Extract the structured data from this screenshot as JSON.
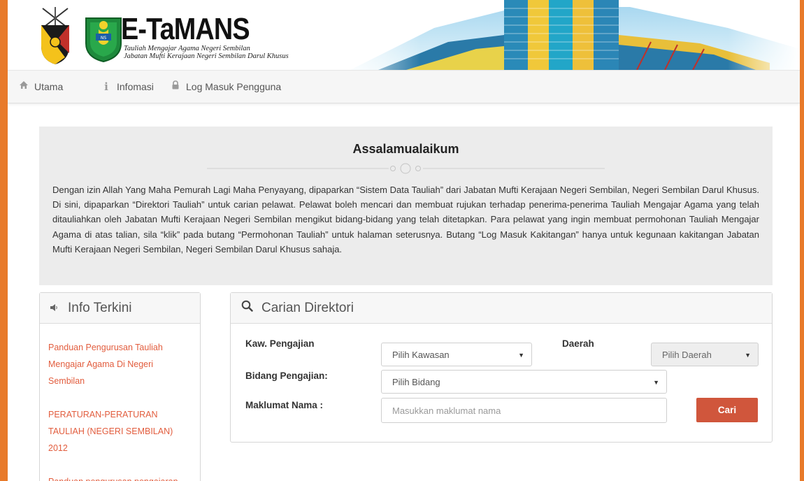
{
  "brand": {
    "title": "E-TaMANS",
    "subtitle_line1": "Tauliah Mengajar Agama Negeri Sembilan",
    "subtitle_line2": "Jabatan Mufti Kerajaan Negeri Sembilan Darul Khusus"
  },
  "nav": {
    "items": [
      {
        "label": "Utama",
        "icon": "home-icon"
      },
      {
        "label": "Infomasi",
        "icon": "info-icon"
      },
      {
        "label": "Log Masuk Pengguna",
        "icon": "lock-icon"
      }
    ]
  },
  "welcome": {
    "title": "Assalamualaikum",
    "text": "Dengan izin Allah Yang Maha Pemurah Lagi Maha Penyayang, dipaparkan “Sistem Data Tauliah” dari Jabatan Mufti Kerajaan Negeri Sembilan, Negeri Sembilan Darul Khusus. Di sini, dipaparkan “Direktori Tauliah” untuk carian pelawat. Pelawat boleh mencari dan membuat rujukan terhadap penerima-penerima Tauliah Mengajar Agama yang telah ditauliahkan oleh Jabatan Mufti Kerajaan Negeri Sembilan mengikut bidang-bidang yang telah ditetapkan. Para pelawat yang ingin membuat permohonan Tauliah Mengajar Agama di atas talian, sila “klik” pada butang “Permohonan Tauliah” untuk halaman seterusnya. Butang “Log Masuk Kakitangan” hanya untuk kegunaan kakitangan Jabatan Mufti Kerajaan Negeri Sembilan, Negeri Sembilan Darul Khusus sahaja."
  },
  "info": {
    "title": "Info Terkini",
    "icon": "speaker-icon",
    "links": [
      "Panduan Pengurusan Tauliah Mengajar Agama Di Negeri Sembilan",
      "PERATURAN-PERATURAN TAULIAH (NEGERI SEMBILAN) 2012",
      "Panduan pengurusan pengajaran"
    ]
  },
  "search": {
    "title": "Carian Direktori",
    "icon": "search-icon",
    "kawasan_label": "Kaw. Pengajian",
    "kawasan_value": "Pilih Kawasan",
    "daerah_label": "Daerah",
    "daerah_value": "Pilih Daerah",
    "bidang_label": "Bidang Pengajian:",
    "bidang_value": "Pilih Bidang",
    "nama_label": "Maklumat Nama :",
    "nama_placeholder": "Masukkan maklumat nama",
    "nama_value": "",
    "button_label": "Cari"
  },
  "colors": {
    "accent_orange": "#e87a2a",
    "link": "#e25d3e",
    "button": "#d0563c"
  }
}
